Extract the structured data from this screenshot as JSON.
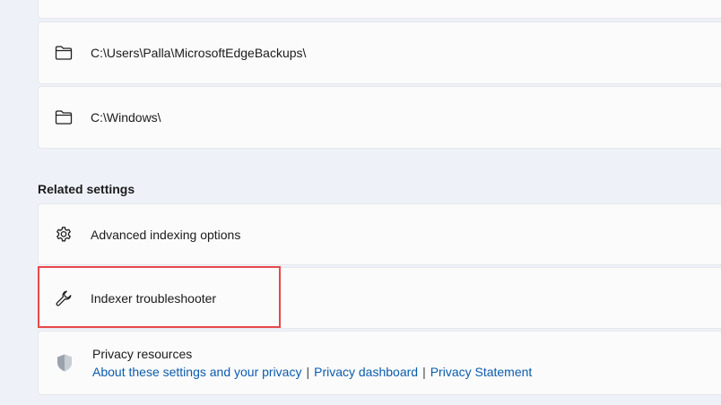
{
  "folders": [
    {
      "path": "C:\\Users\\Palla\\MicrosoftEdgeBackups\\",
      "icon": "folder-icon"
    },
    {
      "path": "C:\\Windows\\",
      "icon": "folder-icon"
    }
  ],
  "related_settings": {
    "title": "Related settings",
    "items": [
      {
        "label": "Advanced indexing options",
        "icon": "gear-icon"
      },
      {
        "label": "Indexer troubleshooter",
        "icon": "wrench-icon"
      }
    ],
    "privacy": {
      "title": "Privacy resources",
      "icon": "shield-icon",
      "links": [
        "About these settings and your privacy",
        "Privacy dashboard",
        "Privacy Statement"
      ],
      "separator": "|"
    }
  },
  "colors": {
    "highlight": "#e8484a",
    "link": "#0b5cad"
  }
}
